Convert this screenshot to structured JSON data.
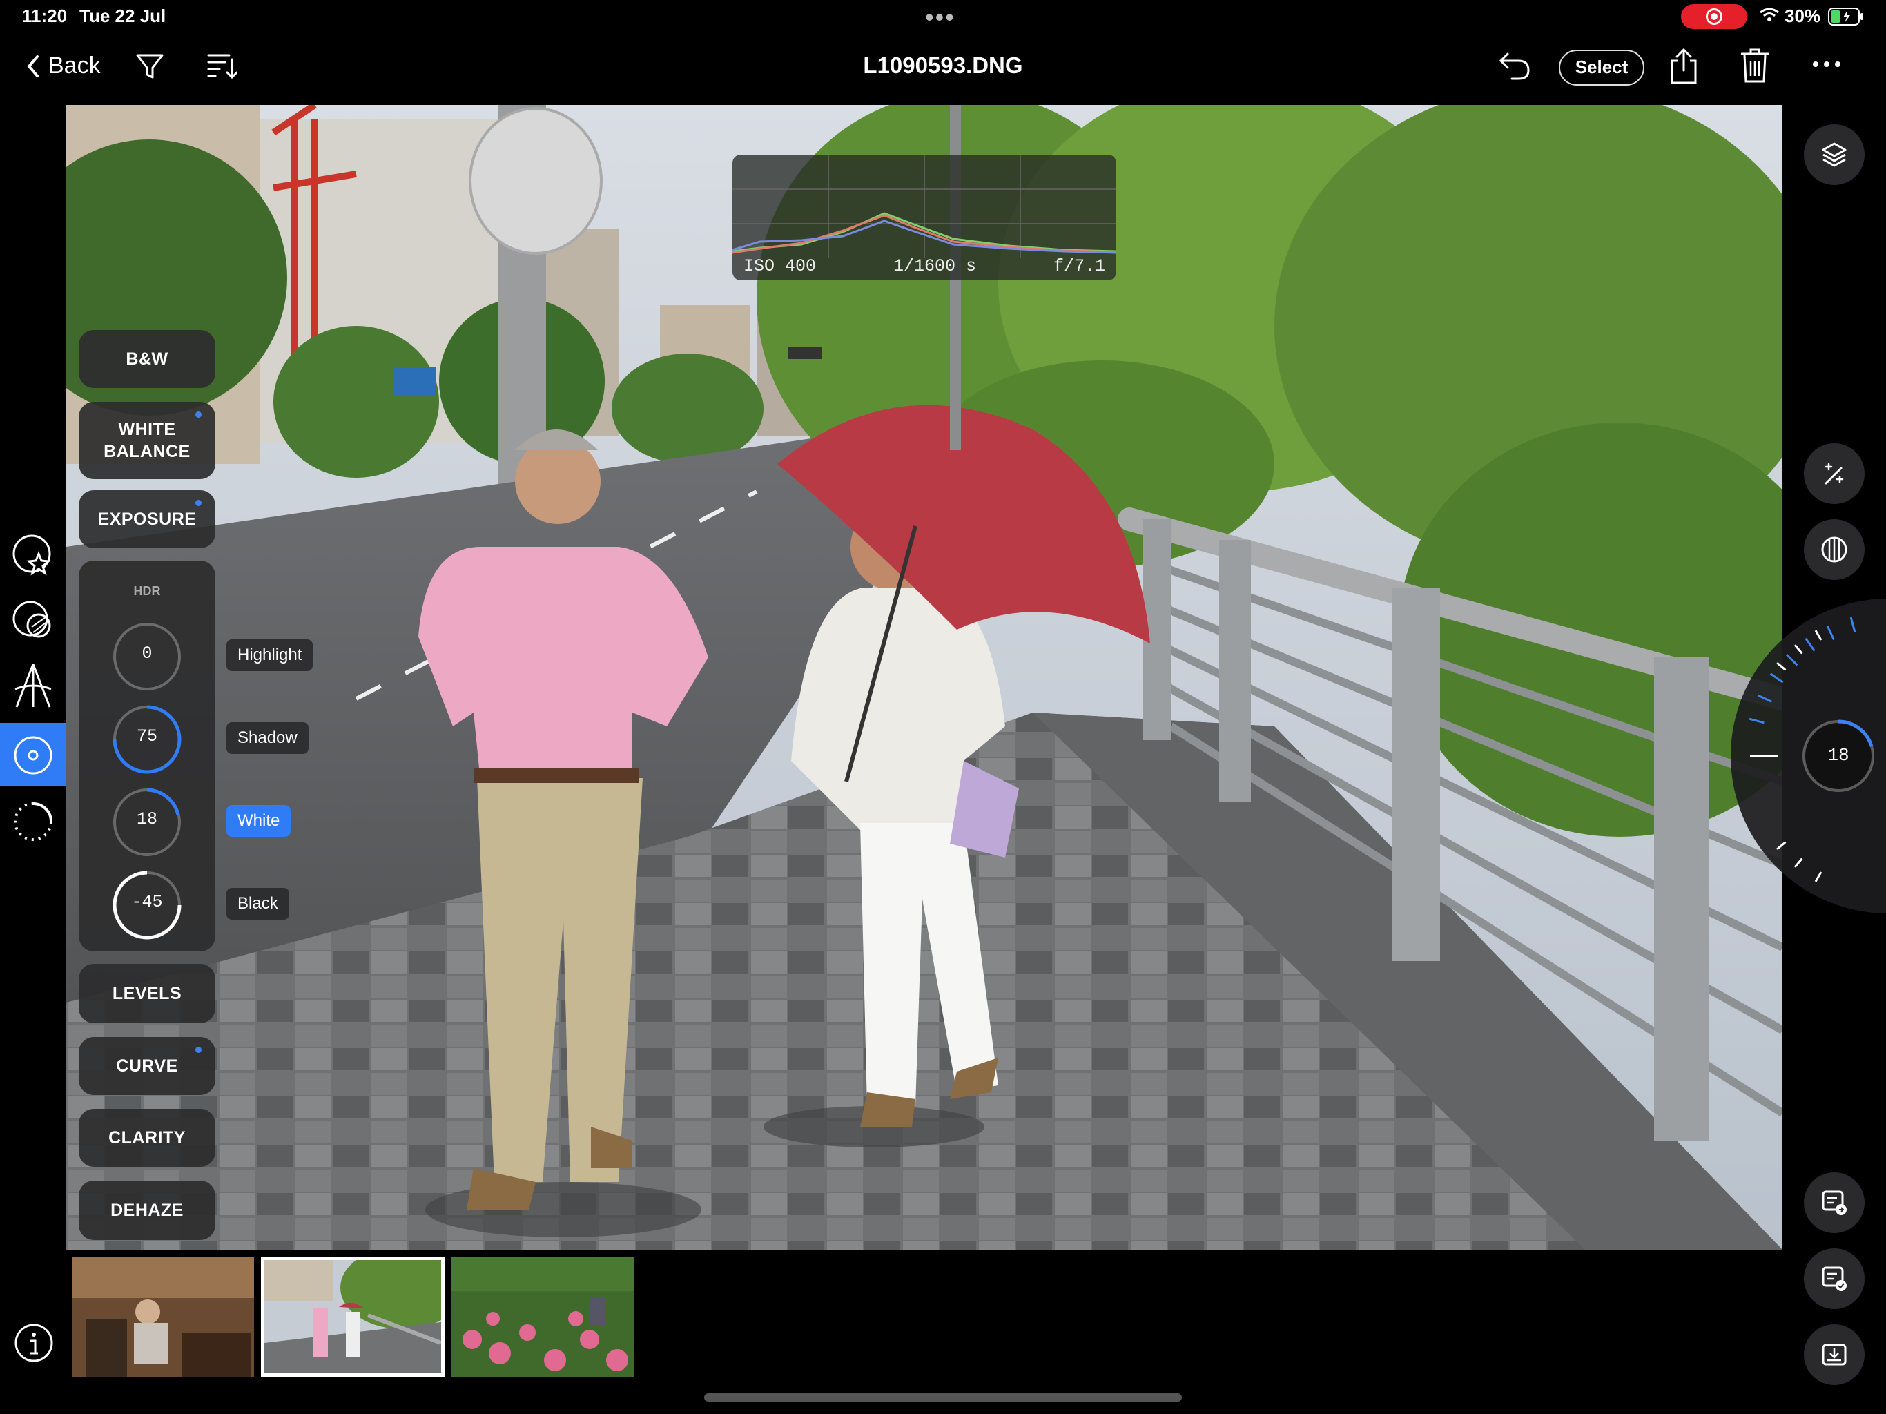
{
  "status_bar": {
    "time": "11:20",
    "date": "Tue 22 Jul",
    "battery": "30%",
    "record_color": "#e5202a"
  },
  "nav": {
    "back_label": "Back",
    "title": "L1090593.DNG",
    "select_label": "Select",
    "icons": [
      "filter-icon",
      "sort-icon",
      "undo-icon",
      "share-icon",
      "trash-icon",
      "more-icon"
    ]
  },
  "histogram": {
    "iso": "ISO 400",
    "shutter": "1/1600 s",
    "aperture": "f/7.1"
  },
  "tools": {
    "bw": "B&W",
    "white_balance_line1": "WHITE",
    "white_balance_line2": "BALANCE",
    "exposure": "EXPOSURE",
    "hdr": {
      "title": "HDR",
      "highlight": {
        "label": "Highlight",
        "value": "0"
      },
      "shadow": {
        "label": "Shadow",
        "value": "75"
      },
      "white": {
        "label": "White",
        "value": "18"
      },
      "black": {
        "label": "Black",
        "value": "-45"
      },
      "active": "White"
    },
    "levels": "LEVELS",
    "curve": "CURVE",
    "clarity": "CLARITY",
    "dehaze": "DEHAZE"
  },
  "wheel": {
    "value": "18"
  },
  "accent_color": "#2f7cf6",
  "filmstrip": {
    "count": 3,
    "selected_index": 1
  }
}
